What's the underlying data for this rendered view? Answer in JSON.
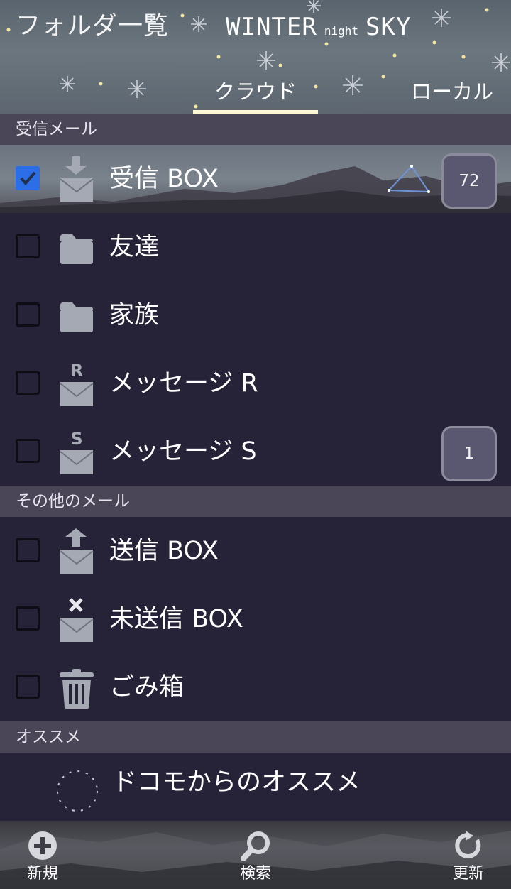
{
  "header": {
    "title": "フォルダ一覧",
    "logo": {
      "word1": "WINTER",
      "word2": "night",
      "word3": "SKY"
    },
    "tabs": [
      {
        "label": "クラウド",
        "active": true
      },
      {
        "label": "ローカル",
        "active": false
      }
    ]
  },
  "sections": {
    "inbox_mail": "受信メール",
    "other_mail": "その他のメール",
    "recommend": "オススメ"
  },
  "folders": [
    {
      "label": "受信 BOX",
      "icon": "inbox-download-mail-icon",
      "checked": true,
      "badge": "72"
    },
    {
      "label": "友達",
      "icon": "folder-icon",
      "checked": false
    },
    {
      "label": "家族",
      "icon": "folder-icon",
      "checked": false
    },
    {
      "label": "メッセージ R",
      "icon": "message-r-mail-icon",
      "checked": false
    },
    {
      "label": "メッセージ S",
      "icon": "message-s-mail-icon",
      "checked": false,
      "badge": "1"
    },
    {
      "label": "送信 BOX",
      "icon": "outbox-upload-mail-icon",
      "checked": false
    },
    {
      "label": "未送信 BOX",
      "icon": "unsent-mail-icon",
      "checked": false
    },
    {
      "label": "ごみ箱",
      "icon": "trash-icon",
      "checked": false
    }
  ],
  "recommend_item": {
    "label": "ドコモからのオススメ",
    "icon": "dotted-circle-icon"
  },
  "bottom_bar": {
    "new_label": "新規",
    "search_label": "検索",
    "refresh_label": "更新"
  },
  "colors": {
    "background": "#262338",
    "section": "#4a4658",
    "tab_indicator": "#fff6d2",
    "checkbox_checked": "#2c6ee8",
    "icon_gray": "#a5a9b4"
  }
}
